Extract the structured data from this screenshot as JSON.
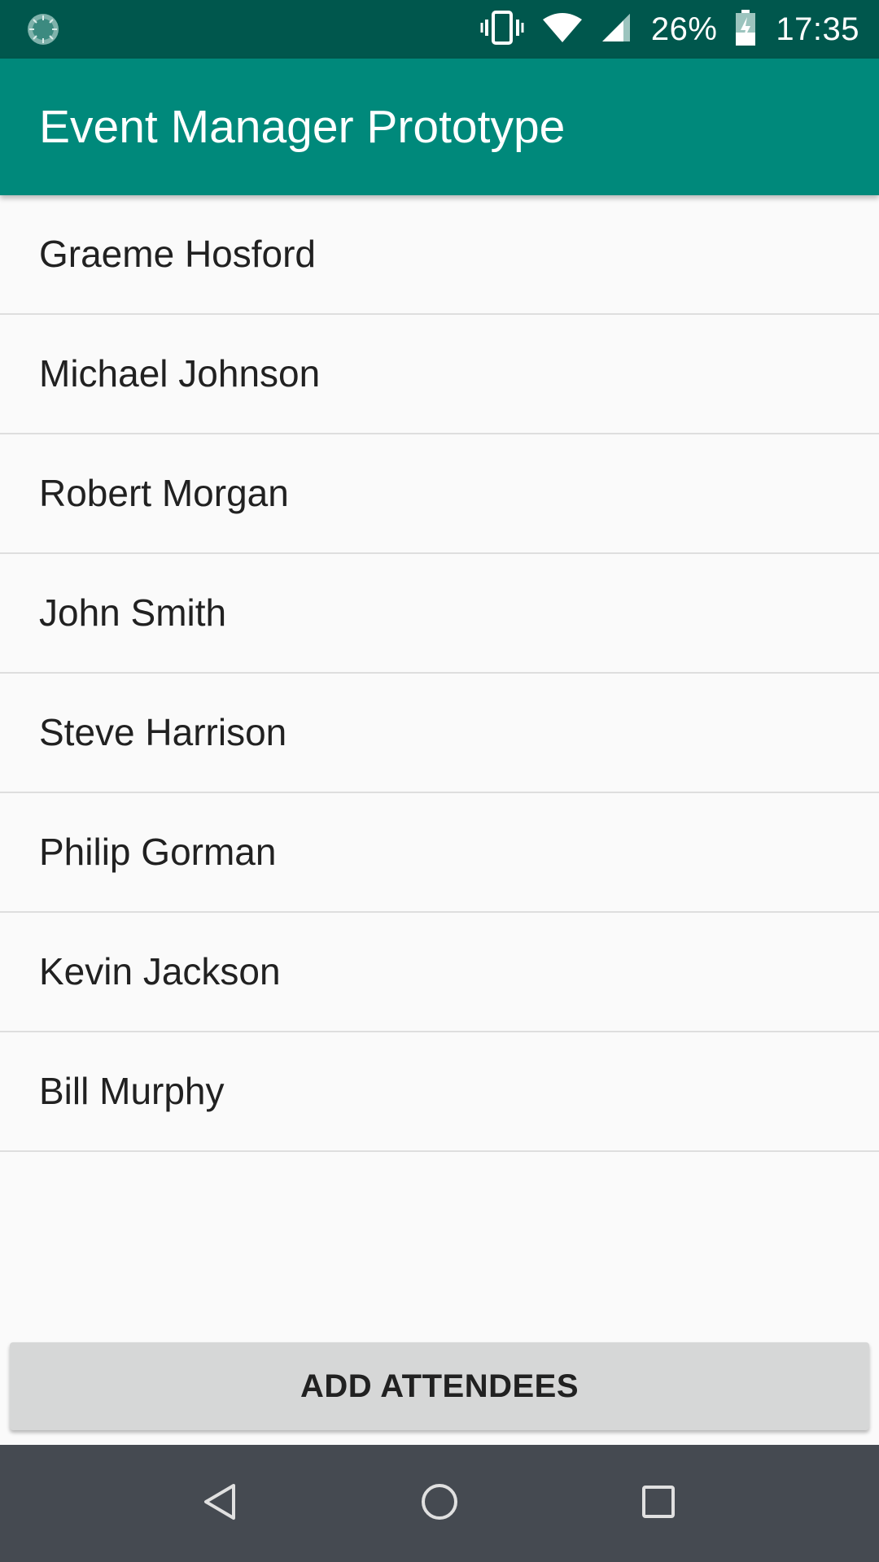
{
  "status_bar": {
    "battery_percent": "26%",
    "time": "17:35",
    "icons": [
      "sync-icon",
      "vibrate-icon",
      "wifi-icon",
      "cell-signal-icon",
      "battery-charging-icon"
    ]
  },
  "app_bar": {
    "title": "Event Manager Prototype"
  },
  "attendees": [
    {
      "name": "Graeme Hosford"
    },
    {
      "name": "Michael Johnson"
    },
    {
      "name": "Robert Morgan"
    },
    {
      "name": "John Smith"
    },
    {
      "name": "Steve Harrison"
    },
    {
      "name": "Philip Gorman"
    },
    {
      "name": "Kevin Jackson"
    },
    {
      "name": "Bill Murphy"
    }
  ],
  "actions": {
    "add_attendees_label": "ADD ATTENDEES"
  },
  "nav_bar": {
    "buttons": [
      "back-icon",
      "home-icon",
      "recents-icon"
    ]
  },
  "colors": {
    "status_bar": "#00574d",
    "primary": "#00897b",
    "background": "#fafafa",
    "divider": "#dedede",
    "button": "#d6d7d7",
    "nav_bar": "#454a51"
  }
}
